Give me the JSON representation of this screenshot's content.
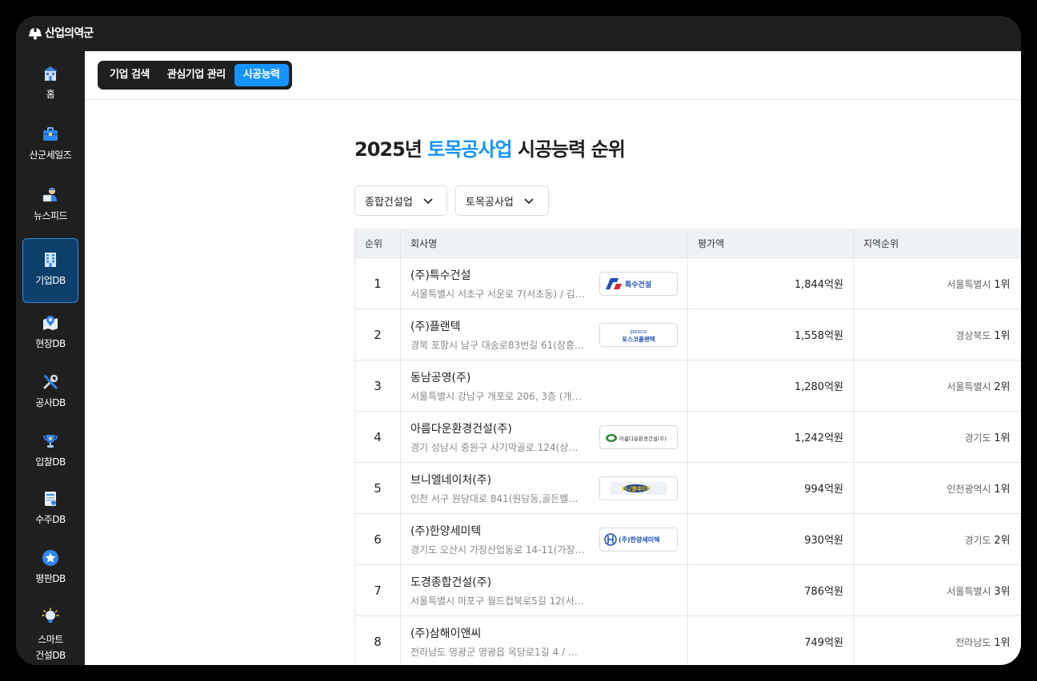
{
  "app": {
    "brand": "산업의역군"
  },
  "sidebar": {
    "items": [
      {
        "label": "홈",
        "icon": "home-building-icon"
      },
      {
        "label": "산군세일즈",
        "icon": "briefcase-icon"
      },
      {
        "label": "뉴스피드",
        "icon": "newsreader-icon"
      },
      {
        "label": "기업DB",
        "icon": "office-building-icon",
        "active": true
      },
      {
        "label": "현장DB",
        "icon": "map-pin-icon"
      },
      {
        "label": "공사DB",
        "icon": "tools-icon"
      },
      {
        "label": "입찰DB",
        "icon": "trophy-icon"
      },
      {
        "label": "수주DB",
        "icon": "document-icon"
      },
      {
        "label": "평판DB",
        "icon": "star-badge-icon"
      },
      {
        "label": "스마트",
        "label2": "건설DB",
        "icon": "lightbulb-icon"
      }
    ]
  },
  "tabs": [
    {
      "label": "기업 검색"
    },
    {
      "label": "관심기업 관리"
    },
    {
      "label": "시공능력",
      "active": true
    }
  ],
  "page": {
    "title_prefix": "2025년 ",
    "title_highlight": "토목공사업",
    "title_suffix": " 시공능력 순위"
  },
  "filters": {
    "industry": "종합건설업",
    "category": "토목공사업"
  },
  "table": {
    "headers": [
      "순위",
      "회사명",
      "평가액",
      "지역순위"
    ],
    "rows": [
      {
        "rank": "1",
        "name": "(주)특수건설",
        "address": "서울특별시 서초구 서운로 7(서초동) / 김…",
        "amount": "1,844억원",
        "region": "서울특별시",
        "region_rank": "1위",
        "logo": "특수건설"
      },
      {
        "rank": "2",
        "name": "(주)플랜텍",
        "address": "경북 포항시 남구 대송로83번길 61(장흥…",
        "amount": "1,558억원",
        "region": "경상북도",
        "region_rank": "1위",
        "logo": "포스코플랜텍"
      },
      {
        "rank": "3",
        "name": "동남공영(주)",
        "address": "서울특별시 강남구 개포로 206, 3층 (개포…",
        "amount": "1,280억원",
        "region": "서울특별시",
        "region_rank": "2위"
      },
      {
        "rank": "4",
        "name": "아름다운환경건설(주)",
        "address": "경기 성남시 중원구 사기막골로 124(상대…",
        "amount": "1,242억원",
        "region": "경기도",
        "region_rank": "1위",
        "logo": "아름다운환경건설(주)"
      },
      {
        "rank": "5",
        "name": "브니엘네이처(주)",
        "address": "인천 서구 원당대로 841(원당동,골든벨프…",
        "amount": "994억원",
        "region": "인천광역시",
        "region_rank": "1위",
        "logo": "브니엘네이처"
      },
      {
        "rank": "6",
        "name": "(주)한양세미텍",
        "address": "경기도 오산시 가장산업동로 14-11(가장…",
        "amount": "930억원",
        "region": "경기도",
        "region_rank": "2위",
        "logo": "(주)한양세미텍"
      },
      {
        "rank": "7",
        "name": "도경종합건설(주)",
        "address": "서울특별시 마포구 월드컵북로5길 12(서…",
        "amount": "786억원",
        "region": "서울특별시",
        "region_rank": "3위"
      },
      {
        "rank": "8",
        "name": "(주)삼해이앤씨",
        "address": "전라남도 영광군 영광읍 옥당로1길 4 / 정…",
        "amount": "749억원",
        "region": "전라남도",
        "region_rank": "1위"
      }
    ]
  },
  "colors": {
    "accent": "#1593ff",
    "sidebar_bg": "#1f1f1f",
    "active_nav_bg": "#0e3f6b"
  }
}
